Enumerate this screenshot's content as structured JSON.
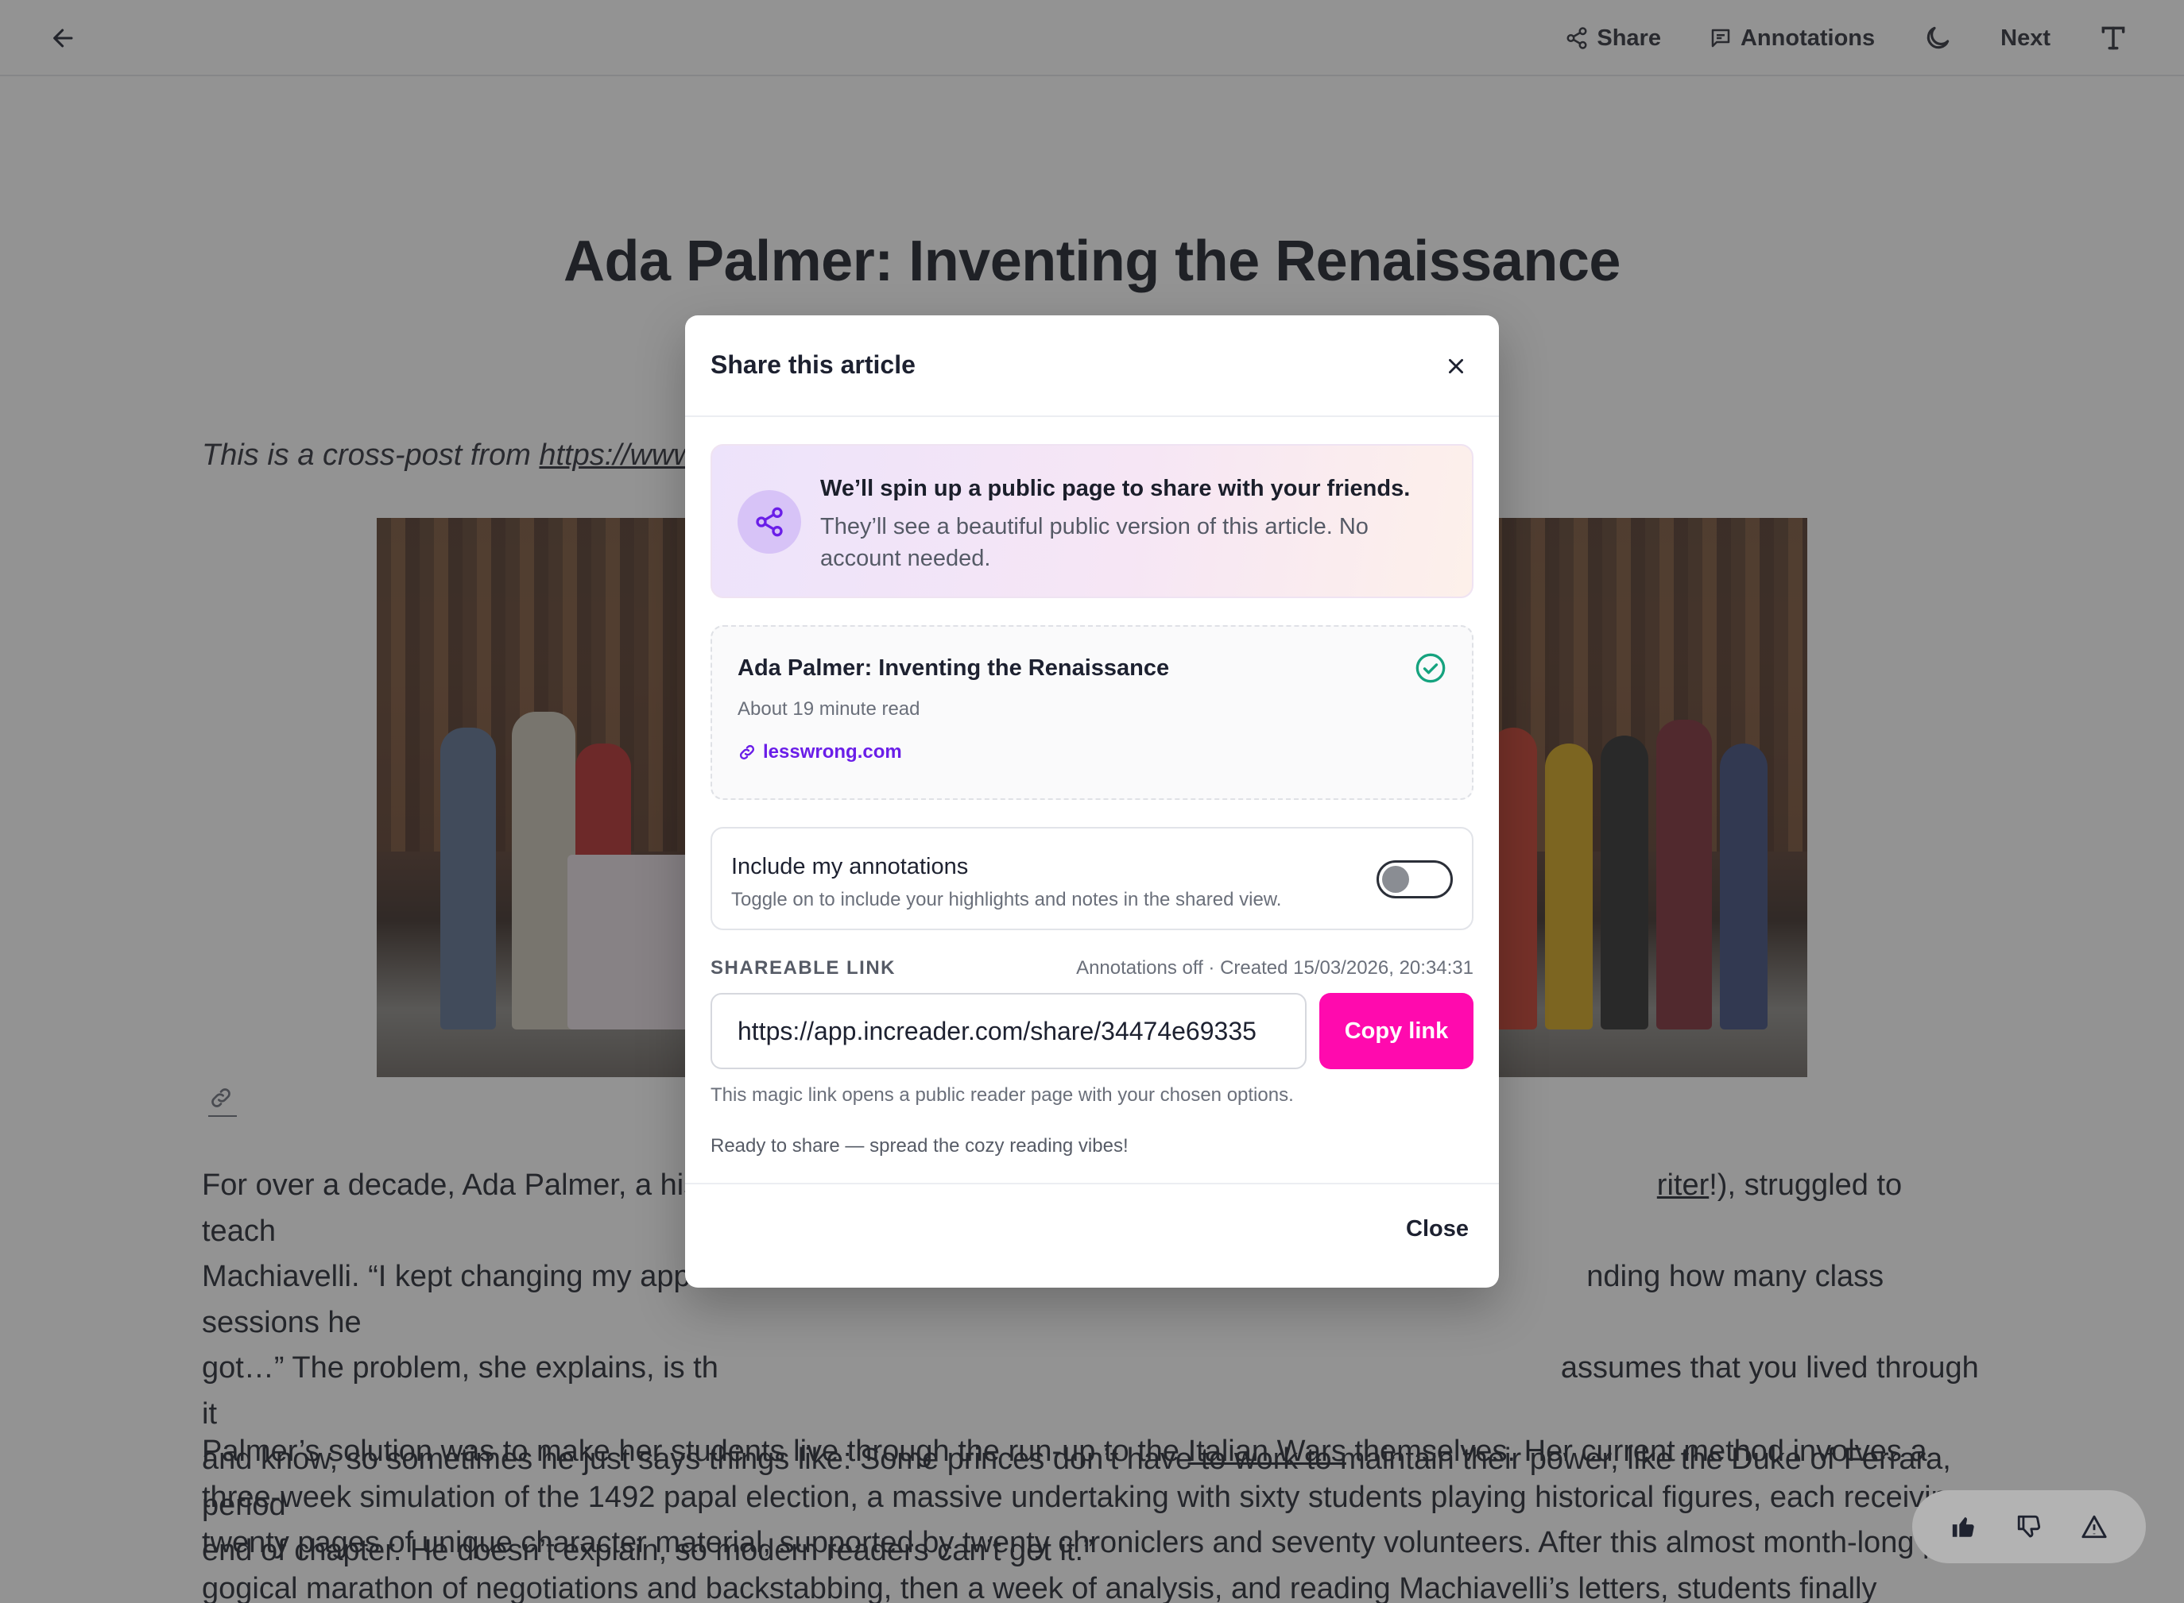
{
  "topbar": {
    "share_label": "Share",
    "annotations_label": "Annotations",
    "next_label": "Next"
  },
  "article": {
    "title": "Ada Palmer: Inventing the Renaissance",
    "crosspost_prefix": "This is a cross-post from ",
    "crosspost_link": "https://www",
    "para1_a": "For over a decade, Ada Palmer, a hist",
    "para1_link": "riter",
    "para1_b": "!), struggled to teach",
    "para1_l2a": "Machiavelli. “I kept changing my appr",
    "para1_l2b": "nding how many class sessions he",
    "para1_l3a": "got…” The problem, she explains, is th",
    "para1_l3b": "assumes that you lived through it",
    "para1_l4": "and know, so sometimes he just says things like: Some princes don’t have to work to maintain their power, like the Duke of Ferrara, period",
    "para1_l5": "end of chapter. He doesn’t explain, so modern readers can’t get it.”",
    "para2_l1a": "Palmer’s solution was to make her students live through the run-up to the ",
    "para2_link": "Italian Wars",
    "para2_l1b": " themselves. Her current method involves a",
    "para2_l2": "three-week simulation of the 1492 papal election, a massive undertaking with sixty students playing historical figures, each receiving",
    "para2_l3": "twenty pages of unique character material, supported by twenty chroniclers and seventy volunteers. After this almost month-long p",
    "para2_l4": "gogical marathon of negotiations and backstabbing, then a week of analysis, and reading Machiavelli’s letters, students finally encounter"
  },
  "modal": {
    "title": "Share this article",
    "info_heading": "We’ll spin up a public page to share with your friends.",
    "info_sub": "They’ll see a beautiful public version of this article. No account needed.",
    "article_title": "Ada Palmer: Inventing the Renaissance",
    "read_time": "About 19 minute read",
    "source": "lesswrong.com",
    "toggle_title": "Include my annotations",
    "toggle_sub": "Toggle on to include your highlights and notes in the shared view.",
    "toggle_on": false,
    "link_label": "SHAREABLE LINK",
    "link_meta": "Annotations off · Created 15/03/2026, 20:34:31",
    "link_value": "https://app.increader.com/share/34474e69335",
    "copy_label": "Copy link",
    "magic_note": "This magic link opens a public reader page with your chosen options.",
    "ready_note": "Ready to share — spread the cozy reading vibes!",
    "close_label": "Close"
  },
  "colors": {
    "accent_pink": "#ff0aae",
    "link_purple": "#6a1ee8",
    "check_green": "#16a37f"
  },
  "icons": [
    "back-arrow-icon",
    "share-icon",
    "annotations-icon",
    "moon-icon",
    "text-size-icon",
    "close-icon",
    "check-circle-icon",
    "link-icon",
    "thumbs-up-icon",
    "thumbs-down-icon",
    "warning-icon"
  ]
}
